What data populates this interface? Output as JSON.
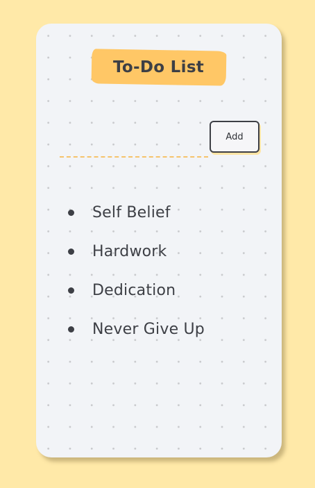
{
  "header": {
    "title": "To-Do List"
  },
  "input": {
    "value": "",
    "placeholder": ""
  },
  "add_button": {
    "label": "Add"
  },
  "todos": [
    {
      "text": "Self Belief"
    },
    {
      "text": "Hardwork"
    },
    {
      "text": "Dedication"
    },
    {
      "text": "Never Give Up"
    }
  ],
  "colors": {
    "page_background": "#ffe9a8",
    "card_background": "#f2f4f7",
    "dot_grid": "#c8c9cc",
    "accent": "#ffc766",
    "text": "#3d3f45",
    "underline": "#f5c36b"
  }
}
